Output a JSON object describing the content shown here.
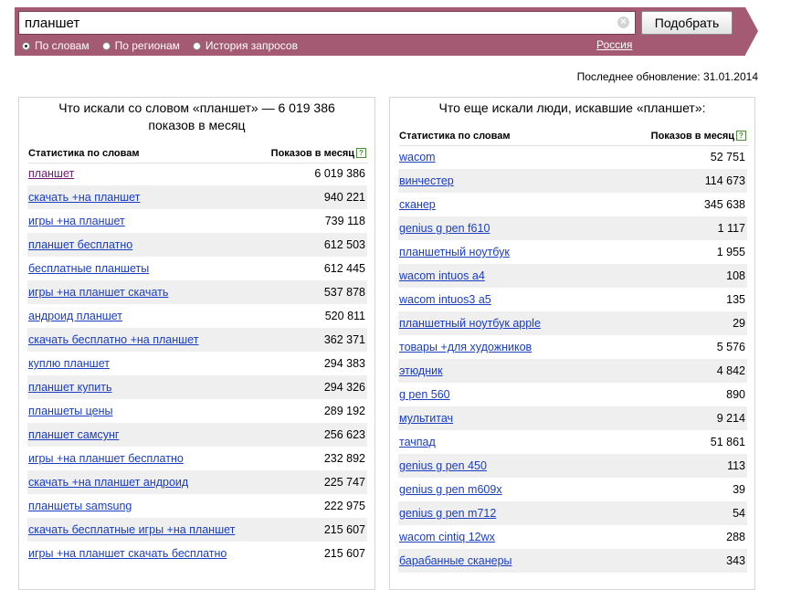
{
  "search": {
    "query": "планшет",
    "submit_label": "Подобрать",
    "clear_glyph": "×",
    "radios": [
      {
        "label": "По словам",
        "selected": true
      },
      {
        "label": "По регионам",
        "selected": false
      },
      {
        "label": "История запросов",
        "selected": false
      }
    ],
    "region": "Россия"
  },
  "last_update": "Последнее обновление: 31.01.2014",
  "left": {
    "title": "Что искали со словом «планшет» — 6 019 386 показов в месяц",
    "col_stats": "Статистика по словам",
    "col_views": "Показов в месяц",
    "help_glyph": "?",
    "rows": [
      {
        "phrase": "планшет",
        "count": "6 019 386",
        "visited": true
      },
      {
        "phrase": "скачать +на планшет",
        "count": "940 221"
      },
      {
        "phrase": "игры +на планшет",
        "count": "739 118"
      },
      {
        "phrase": "планшет бесплатно",
        "count": "612 503"
      },
      {
        "phrase": "бесплатные планшеты",
        "count": "612 445"
      },
      {
        "phrase": "игры +на планшет скачать",
        "count": "537 878"
      },
      {
        "phrase": "андроид планшет",
        "count": "520 811"
      },
      {
        "phrase": "скачать бесплатно +на планшет",
        "count": "362 371"
      },
      {
        "phrase": "куплю планшет",
        "count": "294 383"
      },
      {
        "phrase": "планшет купить",
        "count": "294 326"
      },
      {
        "phrase": "планшеты цены",
        "count": "289 192"
      },
      {
        "phrase": "планшет самсунг",
        "count": "256 623"
      },
      {
        "phrase": "игры +на планшет бесплатно",
        "count": "232 892"
      },
      {
        "phrase": "скачать +на планшет андроид",
        "count": "225 747"
      },
      {
        "phrase": "планшеты samsung",
        "count": "222 975"
      },
      {
        "phrase": "скачать бесплатные игры +на планшет",
        "count": "215 607"
      },
      {
        "phrase": "игры +на планшет скачать бесплатно",
        "count": "215 607"
      }
    ]
  },
  "right": {
    "title": "Что еще искали люди, искавшие «планшет»:",
    "col_stats": "Статистика по словам",
    "col_views": "Показов в месяц",
    "help_glyph": "?",
    "rows": [
      {
        "phrase": "wacom",
        "count": "52 751"
      },
      {
        "phrase": "винчестер",
        "count": "114 673"
      },
      {
        "phrase": "сканер",
        "count": "345 638"
      },
      {
        "phrase": "genius g pen f610",
        "count": "1 117"
      },
      {
        "phrase": "планшетный ноутбук",
        "count": "1 955"
      },
      {
        "phrase": "wacom intuos a4",
        "count": "108"
      },
      {
        "phrase": "wacom intuos3 a5",
        "count": "135"
      },
      {
        "phrase": "планшетный ноутбук apple",
        "count": "29"
      },
      {
        "phrase": "товары +для художников",
        "count": "5 576"
      },
      {
        "phrase": "этюдник",
        "count": "4 842"
      },
      {
        "phrase": "g pen 560",
        "count": "890"
      },
      {
        "phrase": "мультитач",
        "count": "9 214"
      },
      {
        "phrase": "тачпад",
        "count": "51 861"
      },
      {
        "phrase": "genius g pen 450",
        "count": "113"
      },
      {
        "phrase": "genius g pen m609x",
        "count": "39"
      },
      {
        "phrase": "genius g pen m712",
        "count": "54"
      },
      {
        "phrase": "wacom cintiq 12wx",
        "count": "288"
      },
      {
        "phrase": "барабанные сканеры",
        "count": "343"
      }
    ]
  }
}
